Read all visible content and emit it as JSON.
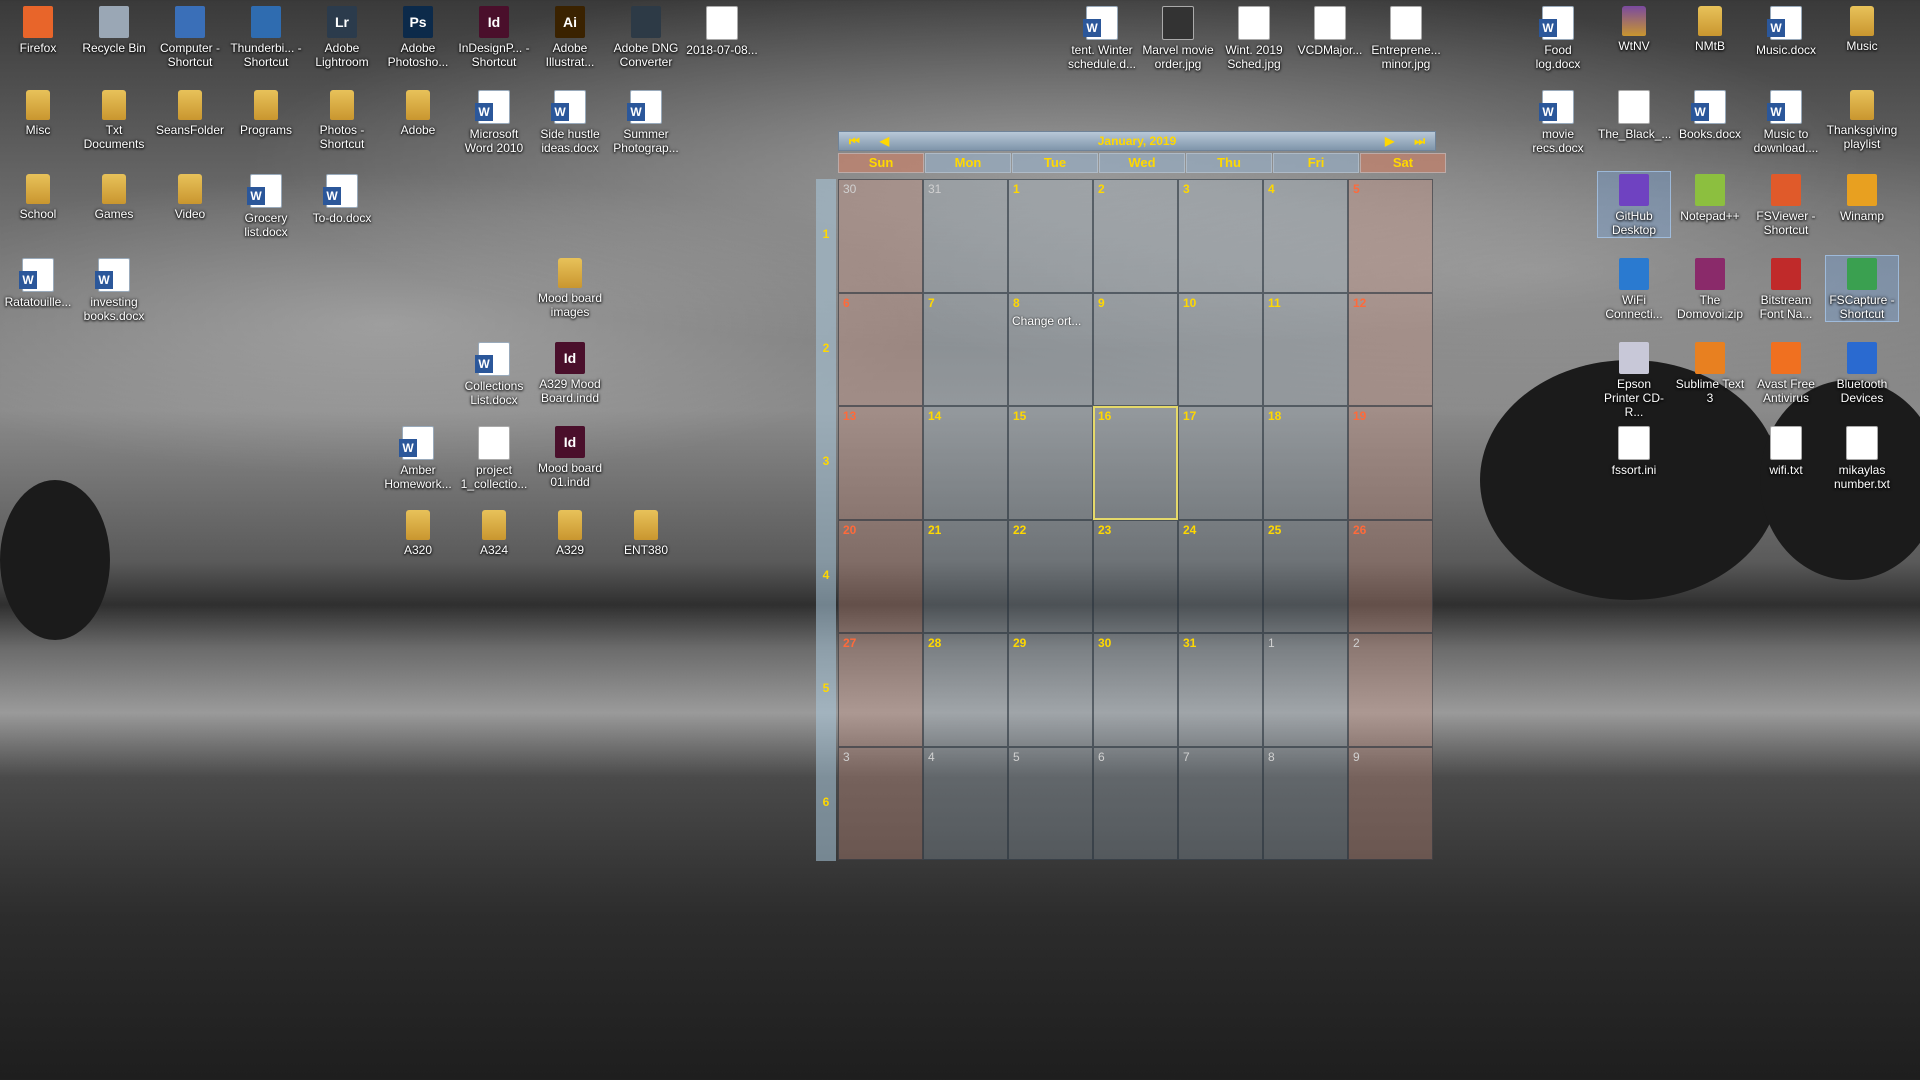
{
  "desktop": {
    "icons": [
      {
        "label": "Firefox",
        "kind": "app",
        "color": "#e8652a"
      },
      {
        "label": "Recycle Bin",
        "kind": "app",
        "color": "#9aa7b5"
      },
      {
        "label": "Computer - Shortcut",
        "kind": "app",
        "color": "#3a6fb8"
      },
      {
        "label": "Thunderbi... - Shortcut",
        "kind": "app",
        "color": "#2f6cb0"
      },
      {
        "label": "Adobe Lightroom",
        "kind": "app",
        "color": "#2b3b4c",
        "text": "Lr"
      },
      {
        "label": "Adobe Photosho...",
        "kind": "app",
        "color": "#0c2a4a",
        "text": "Ps"
      },
      {
        "label": "InDesignP... - Shortcut",
        "kind": "app",
        "color": "#4a0f2b",
        "text": "Id"
      },
      {
        "label": "Adobe Illustrat...",
        "kind": "app",
        "color": "#3a2200",
        "text": "Ai"
      },
      {
        "label": "Adobe DNG Converter",
        "kind": "app",
        "color": "#2d3a46"
      },
      {
        "label": "2018-07-08...",
        "kind": "doc",
        "color": "#ffffff"
      },
      {
        "label": "tent. Winter schedule.d...",
        "kind": "word",
        "color": "#2b579a"
      },
      {
        "label": "Marvel movie order.jpg",
        "kind": "doc",
        "color": "#333333"
      },
      {
        "label": "Wint. 2019 Sched.jpg",
        "kind": "doc",
        "color": "#ffffff"
      },
      {
        "label": "VCDMajor...",
        "kind": "doc",
        "color": "#ffffff"
      },
      {
        "label": "Entreprene... minor.jpg",
        "kind": "doc",
        "color": "#ffffff"
      },
      {
        "label": "Food log.docx",
        "kind": "word",
        "color": "#2b579a"
      },
      {
        "label": "WtNV",
        "kind": "folder",
        "color": "#7a4aa0"
      },
      {
        "label": "NMtB",
        "kind": "folder",
        "color": "#e8c25a"
      },
      {
        "label": "Music.docx",
        "kind": "word",
        "color": "#2b579a"
      },
      {
        "label": "Music",
        "kind": "folder",
        "color": "#e8c25a"
      },
      {
        "label": "Misc",
        "kind": "folder",
        "color": "#e8c25a"
      },
      {
        "label": "Txt Documents",
        "kind": "folder",
        "color": "#e8c25a"
      },
      {
        "label": "SeansFolder",
        "kind": "folder",
        "color": "#e8c25a"
      },
      {
        "label": "Programs",
        "kind": "folder",
        "color": "#e8c25a"
      },
      {
        "label": "Photos - Shortcut",
        "kind": "folder",
        "color": "#e8c25a"
      },
      {
        "label": "Adobe",
        "kind": "folder",
        "color": "#e8c25a"
      },
      {
        "label": "Microsoft Word 2010",
        "kind": "word",
        "color": "#2b579a"
      },
      {
        "label": "Side hustle ideas.docx",
        "kind": "word",
        "color": "#2b579a"
      },
      {
        "label": "Summer Photograp...",
        "kind": "word",
        "color": "#2b579a"
      },
      {
        "label": "movie recs.docx",
        "kind": "word",
        "color": "#2b579a"
      },
      {
        "label": "The_Black_...",
        "kind": "doc",
        "color": "#ffffff"
      },
      {
        "label": "Books.docx",
        "kind": "word",
        "color": "#2b579a"
      },
      {
        "label": "Music to download....",
        "kind": "word",
        "color": "#2b579a"
      },
      {
        "label": "Thanksgiving playlist",
        "kind": "folder",
        "color": "#e8c25a"
      },
      {
        "label": "School",
        "kind": "folder",
        "color": "#e8c25a"
      },
      {
        "label": "Games",
        "kind": "folder",
        "color": "#e8c25a"
      },
      {
        "label": "Video",
        "kind": "folder",
        "color": "#e8c25a"
      },
      {
        "label": "Grocery list.docx",
        "kind": "word",
        "color": "#2b579a"
      },
      {
        "label": "To-do.docx",
        "kind": "word",
        "color": "#2b579a"
      },
      {
        "label": "GitHub Desktop",
        "kind": "app",
        "color": "#6f42c1"
      },
      {
        "label": "Notepad++",
        "kind": "app",
        "color": "#8cbf3f"
      },
      {
        "label": "FSViewer - Shortcut",
        "kind": "app",
        "color": "#e05a2a"
      },
      {
        "label": "Winamp",
        "kind": "app",
        "color": "#e8a020"
      },
      {
        "label": "Ratatouille...",
        "kind": "word",
        "color": "#2b579a"
      },
      {
        "label": "investing books.docx",
        "kind": "word",
        "color": "#2b579a"
      },
      {
        "label": "Mood board images",
        "kind": "folder",
        "color": "#e8c25a"
      },
      {
        "label": "WiFi Connecti...",
        "kind": "app",
        "color": "#2a7ad0"
      },
      {
        "label": "The Domovoi.zip",
        "kind": "app",
        "color": "#8a2a6a"
      },
      {
        "label": "Bitstream Font Na...",
        "kind": "app",
        "color": "#c02a2a"
      },
      {
        "label": "FSCapture - Shortcut",
        "kind": "app",
        "color": "#3aa050"
      },
      {
        "label": "Collections List.docx",
        "kind": "word",
        "color": "#2b579a"
      },
      {
        "label": "A329 Mood Board.indd",
        "kind": "app",
        "color": "#4a0f2b",
        "text": "Id"
      },
      {
        "label": "Epson Printer CD-R...",
        "kind": "app",
        "color": "#c8c8d8"
      },
      {
        "label": "Sublime Text 3",
        "kind": "app",
        "color": "#e88020"
      },
      {
        "label": "Avast Free Antivirus",
        "kind": "app",
        "color": "#f07020"
      },
      {
        "label": "Bluetooth Devices",
        "kind": "app",
        "color": "#2a6ad0"
      },
      {
        "label": "Amber Homework...",
        "kind": "word",
        "color": "#2b579a"
      },
      {
        "label": "project 1_collectio...",
        "kind": "doc",
        "color": "#ffffff"
      },
      {
        "label": "Mood board 01.indd",
        "kind": "app",
        "color": "#4a0f2b",
        "text": "Id"
      },
      {
        "label": "fssort.ini",
        "kind": "doc",
        "color": "#ffffff"
      },
      {
        "label": "wifi.txt",
        "kind": "doc",
        "color": "#ffffff"
      },
      {
        "label": "mikaylas number.txt",
        "kind": "doc",
        "color": "#ffffff"
      },
      {
        "label": "A320",
        "kind": "folder",
        "color": "#e8c25a"
      },
      {
        "label": "A324",
        "kind": "folder",
        "color": "#e8c25a"
      },
      {
        "label": "A329",
        "kind": "folder",
        "color": "#e8c25a"
      },
      {
        "label": "ENT380",
        "kind": "folder",
        "color": "#e8c25a"
      }
    ]
  },
  "calendar": {
    "nav": {
      "prev_year": "⏮",
      "prev_month": "◀",
      "next_month": "▶",
      "next_year": "⏭"
    },
    "month_label": "January, 2019",
    "days_of_week": [
      "Sun",
      "Mon",
      "Tue",
      "Wed",
      "Thu",
      "Fri",
      "Sat"
    ],
    "week_numbers": [
      "1",
      "2",
      "3",
      "4",
      "5",
      "6"
    ],
    "cells": [
      {
        "d": "30",
        "other": true
      },
      {
        "d": "31",
        "other": true
      },
      {
        "d": "1"
      },
      {
        "d": "2"
      },
      {
        "d": "3"
      },
      {
        "d": "4"
      },
      {
        "d": "5"
      },
      {
        "d": "6"
      },
      {
        "d": "7"
      },
      {
        "d": "8",
        "event": "Change ort..."
      },
      {
        "d": "9"
      },
      {
        "d": "10"
      },
      {
        "d": "11"
      },
      {
        "d": "12"
      },
      {
        "d": "13"
      },
      {
        "d": "14"
      },
      {
        "d": "15"
      },
      {
        "d": "16",
        "today": true
      },
      {
        "d": "17"
      },
      {
        "d": "18"
      },
      {
        "d": "19"
      },
      {
        "d": "20"
      },
      {
        "d": "21"
      },
      {
        "d": "22"
      },
      {
        "d": "23"
      },
      {
        "d": "24"
      },
      {
        "d": "25"
      },
      {
        "d": "26"
      },
      {
        "d": "27"
      },
      {
        "d": "28"
      },
      {
        "d": "29"
      },
      {
        "d": "30"
      },
      {
        "d": "31"
      },
      {
        "d": "1",
        "other": true
      },
      {
        "d": "2",
        "other": true
      },
      {
        "d": "3",
        "other": true
      },
      {
        "d": "4",
        "other": true
      },
      {
        "d": "5",
        "other": true
      },
      {
        "d": "6",
        "other": true
      },
      {
        "d": "7",
        "other": true
      },
      {
        "d": "8",
        "other": true
      },
      {
        "d": "9",
        "other": true
      }
    ],
    "colors": {
      "accent": "#ffd800",
      "weekend": "#ff6a3a"
    }
  }
}
